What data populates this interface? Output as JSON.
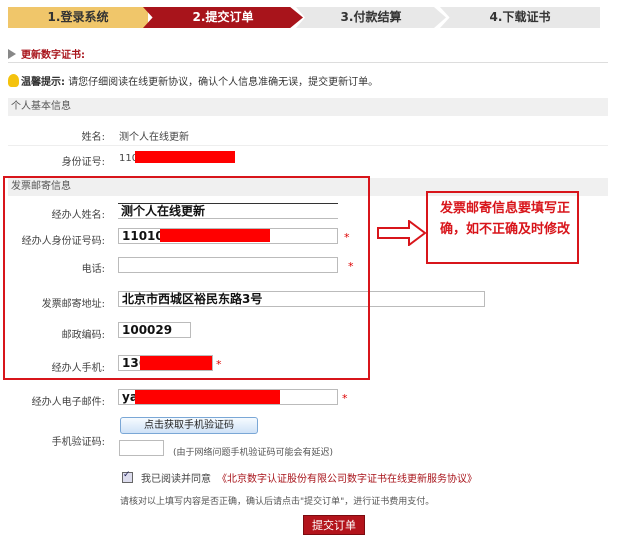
{
  "steps": [
    {
      "label": "1.登录系统"
    },
    {
      "label": "2.提交订单"
    },
    {
      "label": "3.付款结算"
    },
    {
      "label": "4.下载证书"
    }
  ],
  "section_title": "更新数字证书:",
  "tip": {
    "title": "温馨提示:",
    "text": "请您仔细阅读在线更新协议，确认个人信息准确无误，提交更新订单。"
  },
  "basic": {
    "header": "个人基本信息",
    "name_label": "姓名:",
    "name_value": "测个人在线更新",
    "id_label": "身份证号:",
    "id_value": "110"
  },
  "mail": {
    "header": "发票邮寄信息",
    "handler_name_label": "经办人姓名:",
    "handler_name_value": "测个人在线更新",
    "handler_id_label": "经办人身份证号码:",
    "handler_id_value": "11010",
    "phone_label": "电话:",
    "phone_value": "",
    "address_label": "发票邮寄地址:",
    "address_value": "北京市西城区裕民东路3号",
    "zip_label": "邮政编码:",
    "zip_value": "100029",
    "mobile_label": "经办人手机:",
    "mobile_value": "136",
    "email_label": "经办人电子邮件:",
    "email_value": "ya",
    "star": "*"
  },
  "callout": "发票邮寄信息要填写正确，如不正确及时修改",
  "sms": {
    "button": "点击获取手机验证码",
    "label": "手机验证码:",
    "note": "(由于网络问题手机验证码可能会有延迟)"
  },
  "agree": {
    "text": "我已阅读并同意",
    "link": "《北京数字认证股份有限公司数字证书在线更新服务协议》"
  },
  "confirm_text": "请核对以上填写内容是否正确，确认后请点击\"提交订单\"，进行证书费用支付。",
  "submit": "提交订单"
}
